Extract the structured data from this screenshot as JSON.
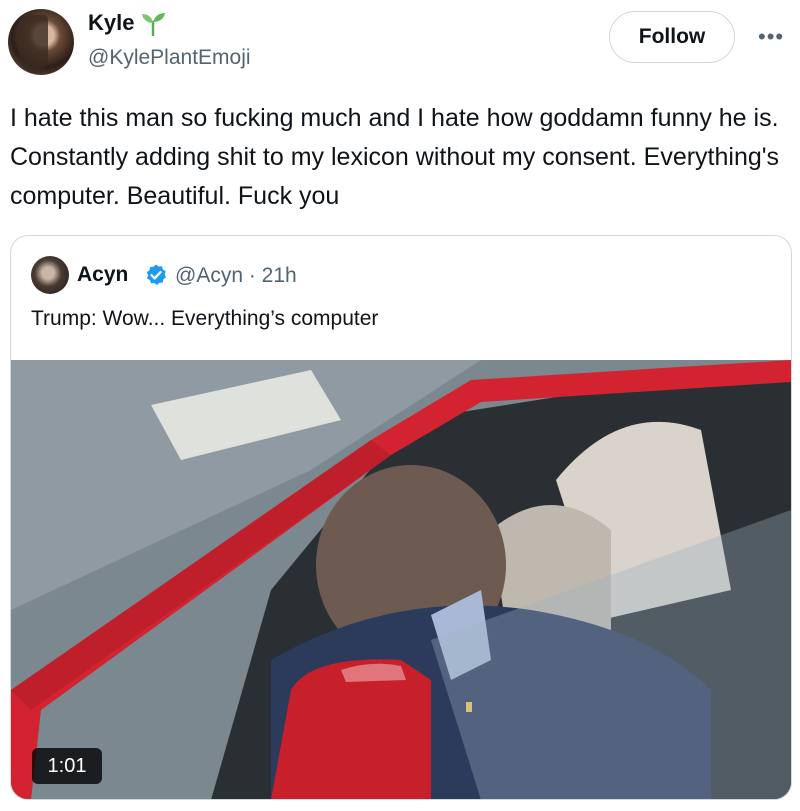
{
  "author": {
    "name": "Kyle",
    "handle": "@KylePlantEmoji",
    "follow_label": "Follow"
  },
  "tweet": {
    "text": "I hate this man so fucking much and I hate how goddamn funny he is. Constantly adding shit to my lexicon without my consent. Everything's computer. Beautiful. Fuck you"
  },
  "quote": {
    "name": "Acyn",
    "handle_time": "@Acyn · 21h",
    "text": "Trump: Wow... Everything’s computer",
    "video_duration": "1:01"
  },
  "colors": {
    "text": "#0f1419",
    "secondary": "#536471",
    "verified": "#1d9bf0",
    "sprout": "#4caf50",
    "car_red": "#d42330"
  },
  "icons": [
    "sprout-icon",
    "more-icon",
    "verified-icon"
  ]
}
